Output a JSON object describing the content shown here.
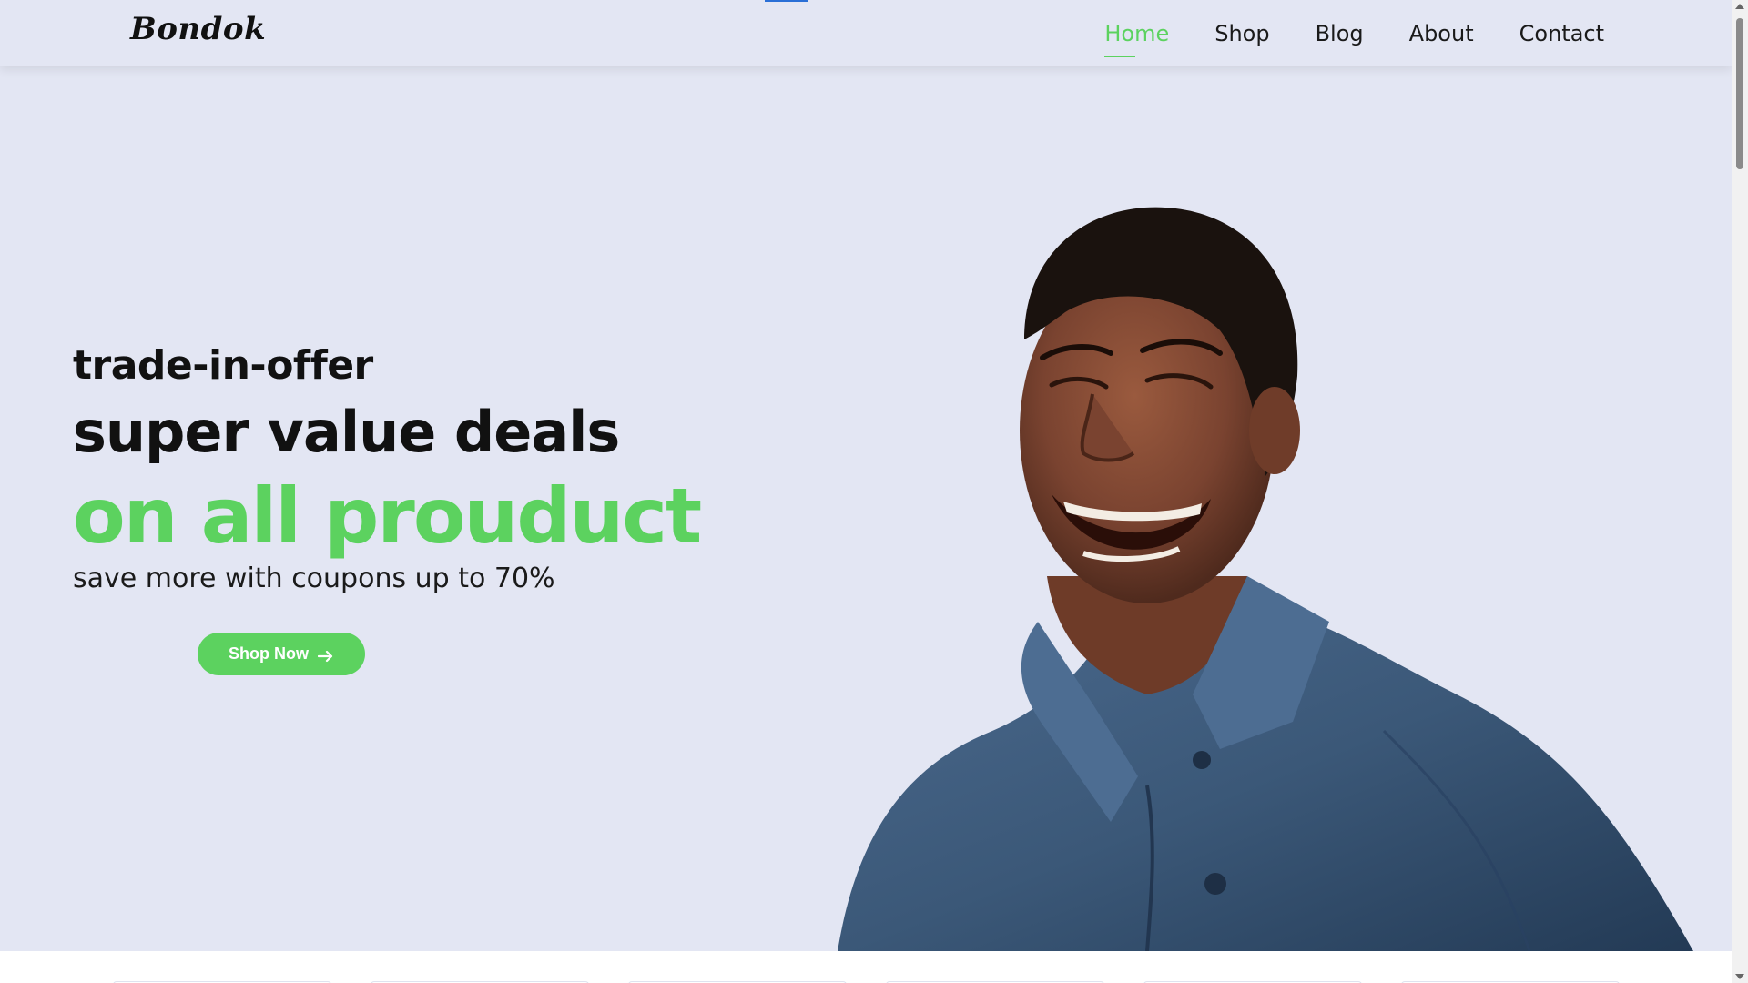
{
  "header": {
    "logo": "Bondok",
    "nav": [
      {
        "label": "Home",
        "active": true
      },
      {
        "label": "Shop",
        "active": false
      },
      {
        "label": "Blog",
        "active": false
      },
      {
        "label": "About",
        "active": false
      },
      {
        "label": "Contact",
        "active": false
      }
    ]
  },
  "hero": {
    "eyebrow": "trade-in-offer",
    "headline": "super value deals",
    "highlight": "on all prouduct",
    "subtext": "save more with coupons up to 70%",
    "cta_label": "Shop Now",
    "cta_icon": "arrow-right-icon",
    "image": "smiling-man-in-blue-jacket"
  },
  "colors": {
    "accent": "#5cd25f",
    "background": "#e3e6f3",
    "text": "#111111",
    "jacket": "#3b5878"
  }
}
